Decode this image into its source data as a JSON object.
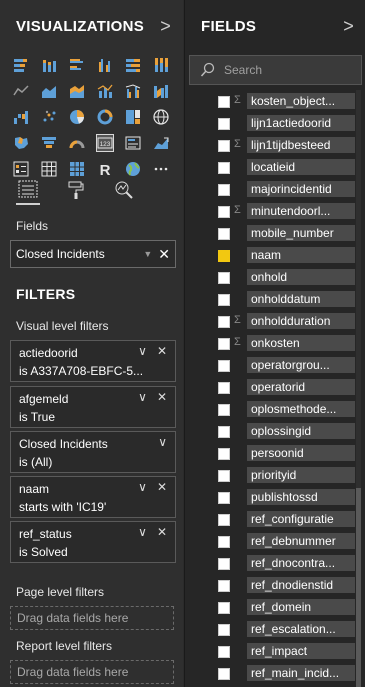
{
  "visualizations": {
    "title": "VISUALIZATIONS",
    "chevron": ">",
    "icons": [
      "stacked-bar-icon",
      "stacked-column-icon",
      "clustered-bar-icon",
      "clustered-column-icon",
      "100-bar-icon",
      "100-column-icon",
      "line-chart-icon",
      "area-chart-icon",
      "stacked-area-icon",
      "line-column-icon",
      "line-clustered-column-icon",
      "ribbon-chart-icon",
      "waterfall-icon",
      "scatter-icon",
      "pie-icon",
      "donut-icon",
      "treemap-icon",
      "map-icon",
      "filled-map-icon",
      "funnel-icon",
      "gauge-icon",
      "card-icon",
      "multirow-card-icon",
      "kpi-icon",
      "slicer-icon",
      "table-icon",
      "matrix-icon",
      "r-visual-icon",
      "globe-icon",
      "more-icon"
    ],
    "more_label": "···",
    "r_label": "R",
    "card_label": "123",
    "tools": [
      "fields-tool-icon",
      "format-paint-icon",
      "analytics-icon"
    ]
  },
  "fields_well": {
    "label": "Fields",
    "value": "Closed Incidents"
  },
  "filters": {
    "title": "FILTERS",
    "visual_level_label": "Visual level filters",
    "cards": [
      {
        "field": "actiedoorid",
        "condition": "is A337A708-EBFC-5...",
        "removable": true
      },
      {
        "field": "afgemeld",
        "condition": "is True",
        "removable": true
      },
      {
        "field": "Closed Incidents",
        "condition": "is (All)",
        "removable": false
      },
      {
        "field": "naam",
        "condition": "starts with 'IC19'",
        "removable": true
      },
      {
        "field": "ref_status",
        "condition": "is Solved",
        "removable": true
      }
    ],
    "page_level_label": "Page level filters",
    "page_drop": "Drag data fields here",
    "report_level_label": "Report level filters",
    "report_drop": "Drag data fields here"
  },
  "fields_pane": {
    "title": "FIELDS",
    "chevron": ">",
    "search_placeholder": "Search",
    "items": [
      {
        "name": "kosten_object...",
        "sigma": true,
        "checked": false
      },
      {
        "name": "lijn1actiedoorid",
        "sigma": false,
        "checked": false
      },
      {
        "name": "lijn1tijdbesteed",
        "sigma": true,
        "checked": false
      },
      {
        "name": "locatieid",
        "sigma": false,
        "checked": false
      },
      {
        "name": "majorincidentid",
        "sigma": false,
        "checked": false
      },
      {
        "name": "minutendoorl...",
        "sigma": true,
        "checked": false
      },
      {
        "name": "mobile_number",
        "sigma": false,
        "checked": false
      },
      {
        "name": "naam",
        "sigma": false,
        "checked": true
      },
      {
        "name": "onhold",
        "sigma": false,
        "checked": false
      },
      {
        "name": "onholddatum",
        "sigma": false,
        "checked": false
      },
      {
        "name": "onholdduration",
        "sigma": true,
        "checked": false
      },
      {
        "name": "onkosten",
        "sigma": true,
        "checked": false
      },
      {
        "name": "operatorgrou...",
        "sigma": false,
        "checked": false
      },
      {
        "name": "operatorid",
        "sigma": false,
        "checked": false
      },
      {
        "name": "oplosmethode...",
        "sigma": false,
        "checked": false
      },
      {
        "name": "oplossingid",
        "sigma": false,
        "checked": false
      },
      {
        "name": "persoonid",
        "sigma": false,
        "checked": false
      },
      {
        "name": "priorityid",
        "sigma": false,
        "checked": false
      },
      {
        "name": "publishtossd",
        "sigma": false,
        "checked": false
      },
      {
        "name": "ref_configuratie",
        "sigma": false,
        "checked": false
      },
      {
        "name": "ref_debnummer",
        "sigma": false,
        "checked": false
      },
      {
        "name": "ref_dnocontra...",
        "sigma": false,
        "checked": false
      },
      {
        "name": "ref_dnodienstid",
        "sigma": false,
        "checked": false
      },
      {
        "name": "ref_domein",
        "sigma": false,
        "checked": false
      },
      {
        "name": "ref_escalation...",
        "sigma": false,
        "checked": false
      },
      {
        "name": "ref_impact",
        "sigma": false,
        "checked": false
      },
      {
        "name": "ref_main_incid...",
        "sigma": false,
        "checked": false
      }
    ]
  },
  "colors": {
    "accent_yellow": "#f2c811",
    "icon_blue": "#5ea0d8",
    "icon_orange": "#e9a13b"
  }
}
